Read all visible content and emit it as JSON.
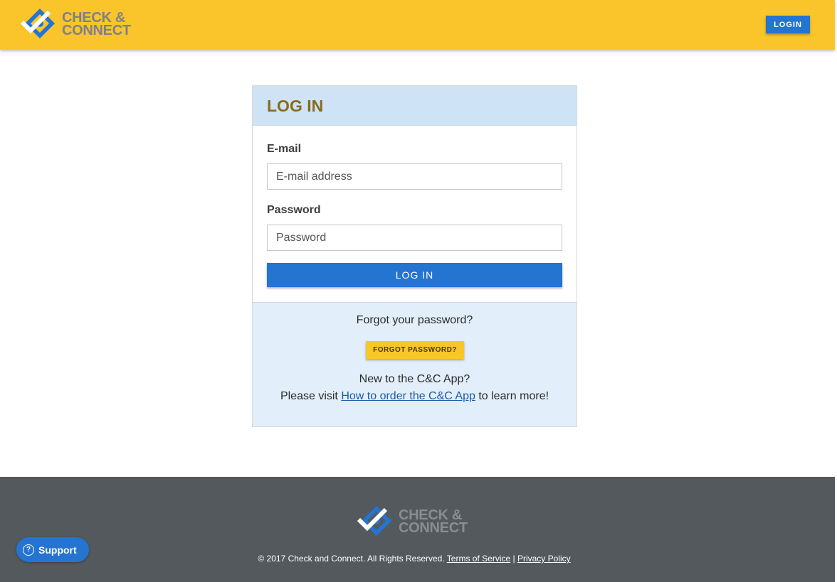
{
  "header": {
    "logo_line1": "CHECK &",
    "logo_line2": "CONNECT",
    "logo_icon": "diamond-check-icon",
    "login_label": "LOGIN"
  },
  "login_card": {
    "title": "LOG IN",
    "email_label": "E-mail",
    "email_placeholder": "E-mail address",
    "email_value": "",
    "password_label": "Password",
    "password_placeholder": "Password",
    "password_value": "",
    "submit_label": "LOG IN",
    "forgot_text": "Forgot your password?",
    "forgot_button": "FORGOT PASSWORD?",
    "new_text": "New to the C&C App?",
    "visit_prefix": "Please visit ",
    "visit_link": "How to order the C&C App",
    "visit_suffix": " to learn more!"
  },
  "footer": {
    "logo_line1": "CHECK &",
    "logo_line2": "CONNECT",
    "copyright": "© 2017 Check and Connect. All Rights Reserved. ",
    "terms_link": "Terms of Service",
    "separator": " | ",
    "privacy_link": "Privacy Policy"
  },
  "support": {
    "label": "Support",
    "icon": "help-circle-icon"
  },
  "colors": {
    "header_bg": "#f9c52b",
    "primary_blue": "#2474d2",
    "card_header_bg": "#cfe3f6",
    "card_footer_bg": "#e2eef9",
    "footer_bg": "#54595d",
    "title_color": "#876b1e"
  }
}
